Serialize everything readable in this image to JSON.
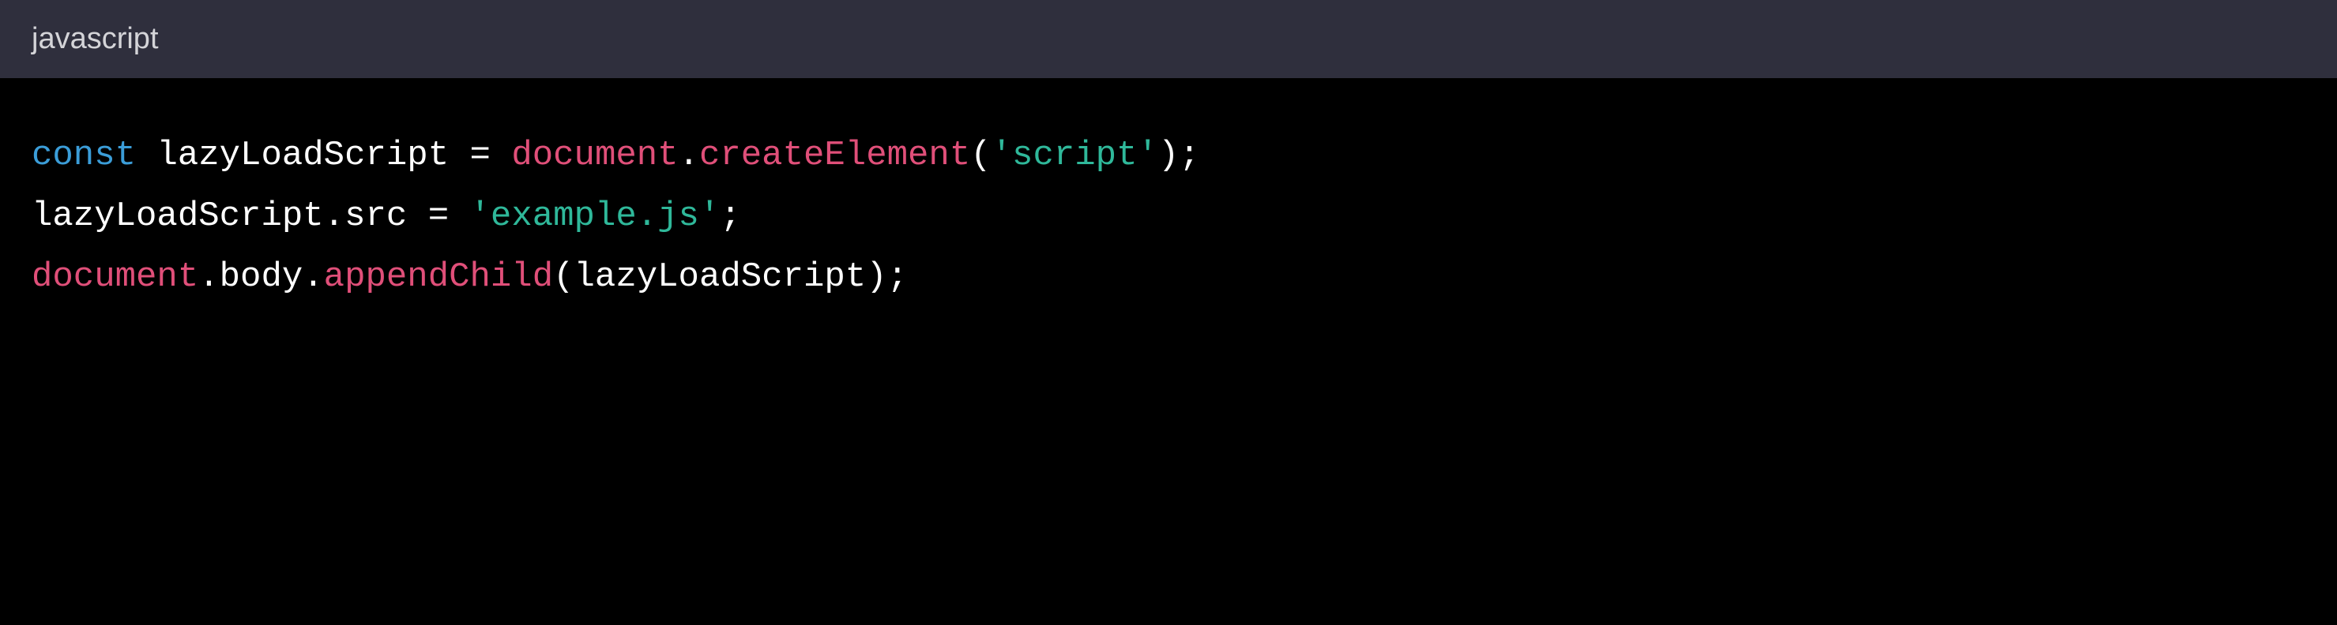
{
  "header": {
    "language": "javascript"
  },
  "code": {
    "line1": {
      "keyword": "const",
      "variable": "lazyLoadScript",
      "operator": "=",
      "object": "document",
      "method": "createElement",
      "string": "'script'"
    },
    "line2": {
      "variable": "lazyLoadScript",
      "property": "src",
      "operator": "=",
      "string": "'example.js'"
    },
    "line3": {
      "object": "document",
      "property": "body",
      "method": "appendChild",
      "variable": "lazyLoadScript"
    }
  }
}
